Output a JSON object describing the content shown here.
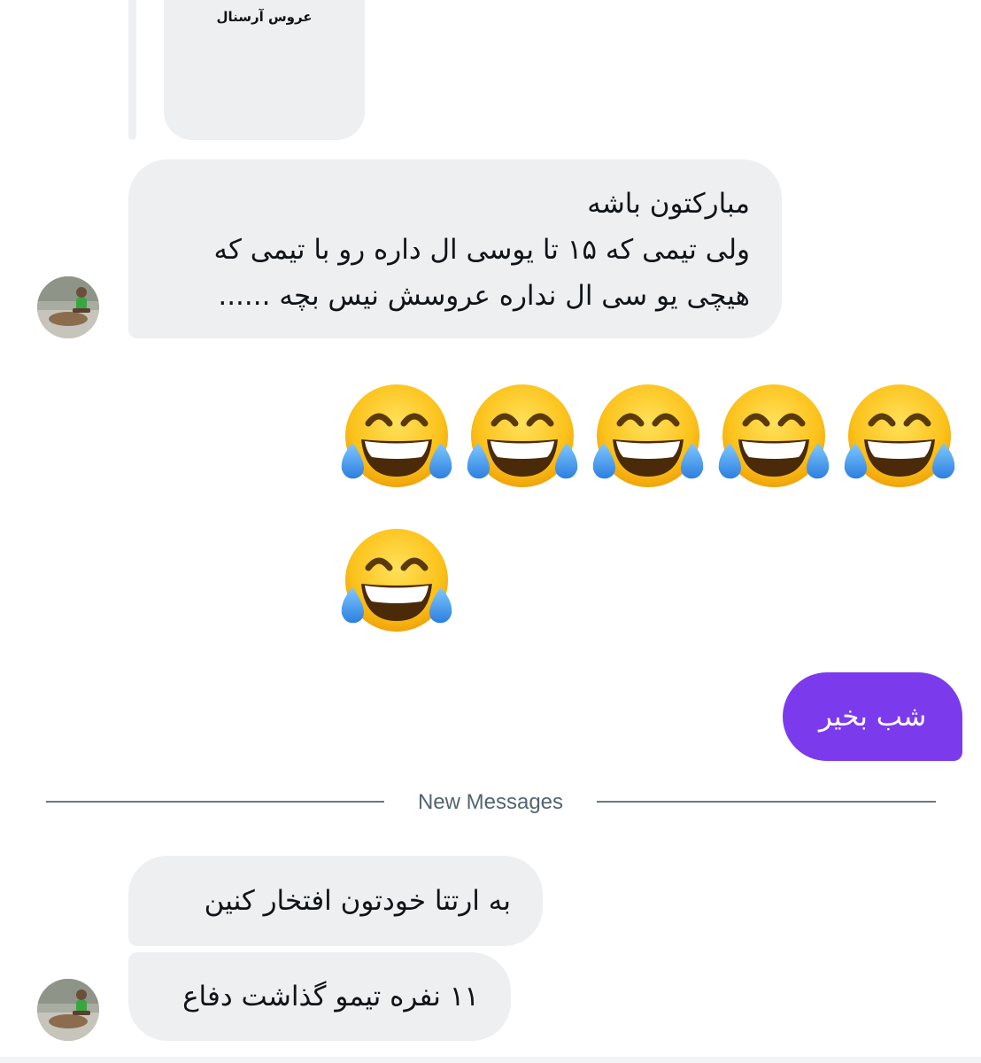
{
  "shared_post": {
    "caption": "عروس آرسنال"
  },
  "messages": {
    "received_1": {
      "lines": [
        "مبارکتون باشه",
        "ولی تیمی که ۱۵ تا یوسی ال داره رو با تیمی که",
        "هیچی یو سی ال نداره عروسش نیس بچه ......"
      ]
    },
    "received_2_emoji": {
      "emoji": "😂",
      "count": 6
    },
    "sent_1": {
      "text": "شب بخیر"
    },
    "received_3": {
      "text": "به ارتتا خودتون افتخار کنین"
    },
    "received_4": {
      "text": "۱۱ نفره تیمو گذاشت دفاع"
    }
  },
  "divider": {
    "label": "New Messages"
  },
  "colors": {
    "received_bubble": "#eeeff1",
    "sent_bubble": "#7c3aed",
    "divider_text": "#536471"
  }
}
